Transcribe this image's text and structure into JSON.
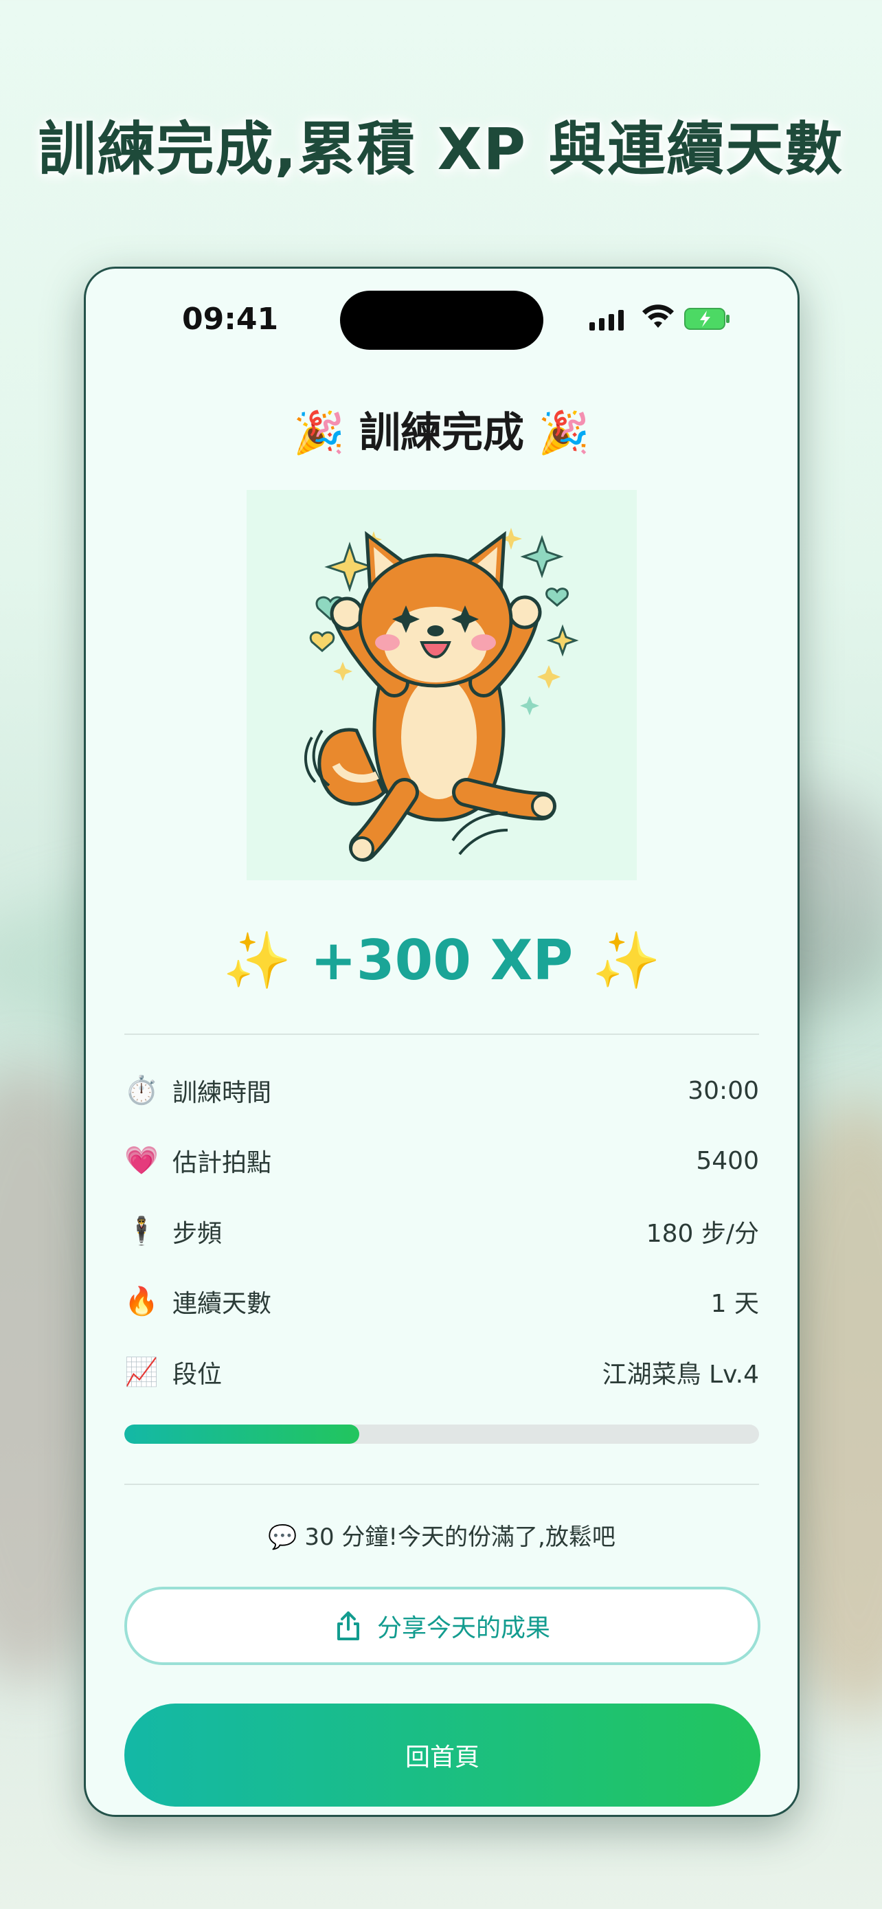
{
  "headline": "訓練完成,累積 XP 與連續天數",
  "status_bar": {
    "time": "09:41"
  },
  "result": {
    "title": "🎉 訓練完成 🎉",
    "xp": "✨ +300 XP ✨"
  },
  "stats": [
    {
      "icon": "⏱️",
      "label": "訓練時間",
      "value": "30:00"
    },
    {
      "icon": "💗",
      "label": "估計拍點",
      "value": "5400"
    },
    {
      "icon": "🕴",
      "label": "步頻",
      "value": "180 步/分"
    },
    {
      "icon": "🔥",
      "label": "連續天數",
      "value": "1 天"
    },
    {
      "icon": "📈",
      "label": "段位",
      "value": "江湖菜鳥 Lv.4"
    }
  ],
  "progress": {
    "fraction": 0.37
  },
  "comment": "💬 30 分鐘!今天的份滿了,放鬆吧",
  "buttons": {
    "share": "分享今天的成果",
    "home": "回首頁"
  },
  "colors": {
    "accent": "#1aa597",
    "gradient_start": "#14b8a6",
    "gradient_end": "#22c55e",
    "headline": "#1e4a3a"
  }
}
